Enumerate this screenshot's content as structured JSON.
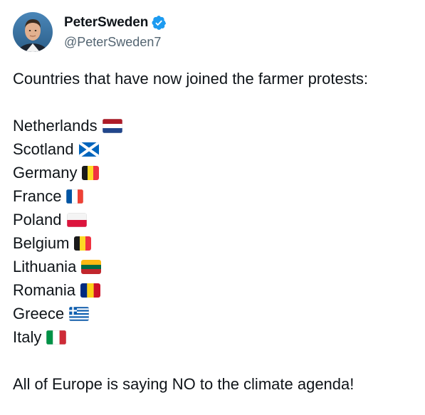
{
  "author": {
    "display_name": "PeterSweden",
    "handle": "@PeterSweden7",
    "verified_icon": "verified-badge-icon",
    "verified_color": "#1d9bf0"
  },
  "tweet": {
    "intro": "Countries that have now joined the farmer protests:",
    "countries": [
      {
        "name": "Netherlands",
        "flag_icon": "flag-netherlands-icon"
      },
      {
        "name": "Scotland",
        "flag_icon": "flag-scotland-icon"
      },
      {
        "name": "Germany",
        "flag_icon": "flag-belgium-icon"
      },
      {
        "name": "France",
        "flag_icon": "flag-france-icon"
      },
      {
        "name": "Poland",
        "flag_icon": "flag-poland-icon"
      },
      {
        "name": "Belgium",
        "flag_icon": "flag-belgium-icon"
      },
      {
        "name": "Lithuania",
        "flag_icon": "flag-lithuania-icon"
      },
      {
        "name": "Romania",
        "flag_icon": "flag-romania-icon"
      },
      {
        "name": "Greece",
        "flag_icon": "flag-greece-icon"
      },
      {
        "name": "Italy",
        "flag_icon": "flag-italy-icon"
      }
    ],
    "closing": "All of Europe is saying NO to the climate agenda!"
  },
  "colors": {
    "text_primary": "#0f1419",
    "text_secondary": "#536471",
    "background": "#ffffff"
  }
}
